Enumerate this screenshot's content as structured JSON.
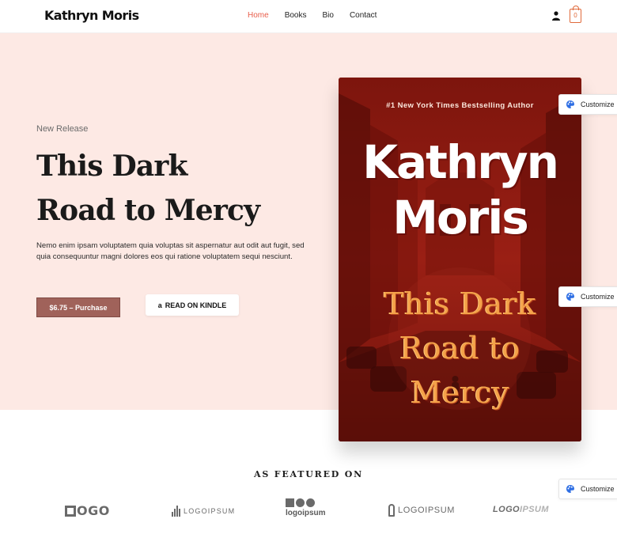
{
  "site": {
    "logo": "Kathryn Moris"
  },
  "nav": {
    "items": [
      "Home",
      "Books",
      "Bio",
      "Contact"
    ],
    "active": "Home"
  },
  "cart": {
    "count": "0"
  },
  "hero": {
    "eyebrow": "New Release",
    "title_line1": "This Dark",
    "title_line2": "Road to Mercy",
    "description": "Nemo enim ipsam voluptatem quia voluptas sit aspernatur aut odit aut fugit, sed quia consequuntur magni dolores eos qui ratione voluptatem sequi nesciunt.",
    "buy_label": "$6.75 – Purchase",
    "kindle_label": "READ ON KINDLE",
    "kindle_icon": "a"
  },
  "book": {
    "tagline": "#1 New York Times Bestselling Author",
    "author_line1": "Kathryn",
    "author_line2": "Moris",
    "title_line1": "This Dark",
    "title_line2": "Road to",
    "title_line3": "Mercy"
  },
  "customize": {
    "label": "Customize"
  },
  "featured": {
    "title": "AS FEATURED ON",
    "logos": [
      {
        "icon": "square-logo-icon",
        "text": "OGO"
      },
      {
        "icon": "bars-logo-icon",
        "text": "LOGOIPSUM"
      },
      {
        "icon": "shapes-logo-icon",
        "text": "logoipsum"
      },
      {
        "icon": "bulb-logo-icon",
        "text": "LOGOIPSUM"
      },
      {
        "icon": "wordmark-logo-icon",
        "text_dark": "LOGO",
        "text_light": "IPSUM"
      }
    ]
  },
  "colors": {
    "accent": "#e85d4a",
    "hero_bg": "#fde9e4",
    "buy_button": "#a0625a",
    "book_red": "#8e1a12",
    "book_title": "#f4a24a"
  }
}
